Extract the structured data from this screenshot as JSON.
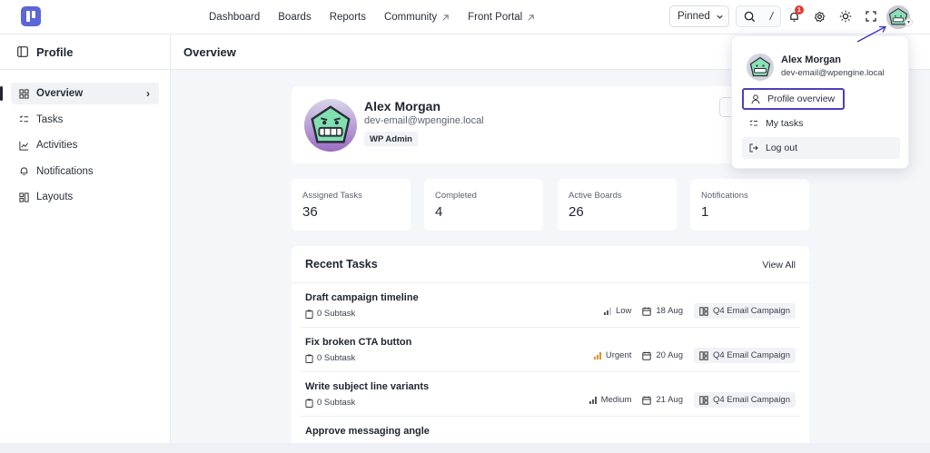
{
  "nav": {
    "items": [
      {
        "label": "Dashboard",
        "external": false
      },
      {
        "label": "Boards",
        "external": false
      },
      {
        "label": "Reports",
        "external": false
      },
      {
        "label": "Community",
        "external": true
      },
      {
        "label": "Front Portal",
        "external": true
      }
    ],
    "pinned_label": "Pinned",
    "search_shortcut": "/",
    "notification_count": "1"
  },
  "sidebar": {
    "title": "Profile",
    "items": [
      {
        "label": "Overview",
        "icon": "grid-icon",
        "active": true
      },
      {
        "label": "Tasks",
        "icon": "checklist-icon",
        "active": false
      },
      {
        "label": "Activities",
        "icon": "chart-line-icon",
        "active": false
      },
      {
        "label": "Notifications",
        "icon": "bell-icon",
        "active": false
      },
      {
        "label": "Layouts",
        "icon": "layout-icon",
        "active": false
      }
    ]
  },
  "main": {
    "title": "Overview",
    "profile": {
      "name": "Alex Morgan",
      "email": "dev-email@wpengine.local",
      "role": "WP Admin"
    },
    "stats": [
      {
        "label": "Assigned Tasks",
        "value": "36"
      },
      {
        "label": "Completed",
        "value": "4"
      },
      {
        "label": "Active Boards",
        "value": "26"
      },
      {
        "label": "Notifications",
        "value": "1"
      }
    ],
    "recent_tasks": {
      "title": "Recent Tasks",
      "view_all": "View All",
      "tasks": [
        {
          "title": "Draft campaign timeline",
          "subtask": "0 Subtask",
          "priority": "Low",
          "date": "18 Aug",
          "board": "Q4 Email Campaign"
        },
        {
          "title": "Fix broken CTA button",
          "subtask": "0 Subtask",
          "priority": "Urgent",
          "date": "20 Aug",
          "board": "Q4 Email Campaign"
        },
        {
          "title": "Write subject line variants",
          "subtask": "0 Subtask",
          "priority": "Medium",
          "date": "21 Aug",
          "board": "Q4 Email Campaign"
        },
        {
          "title": "Approve messaging angle",
          "subtask": "",
          "priority": "",
          "date": "",
          "board": ""
        }
      ]
    }
  },
  "dropdown": {
    "name": "Alex Morgan",
    "email": "dev-email@wpengine.local",
    "items": [
      {
        "label": "Profile overview",
        "icon": "user-icon"
      },
      {
        "label": "My tasks",
        "icon": "checklist-icon"
      },
      {
        "label": "Log out",
        "icon": "logout-icon"
      }
    ]
  },
  "colors": {
    "accent": "#5a67d8",
    "highlight_border": "#4b3fc0",
    "badge": "#e53935",
    "urgent": "#f08a24"
  }
}
